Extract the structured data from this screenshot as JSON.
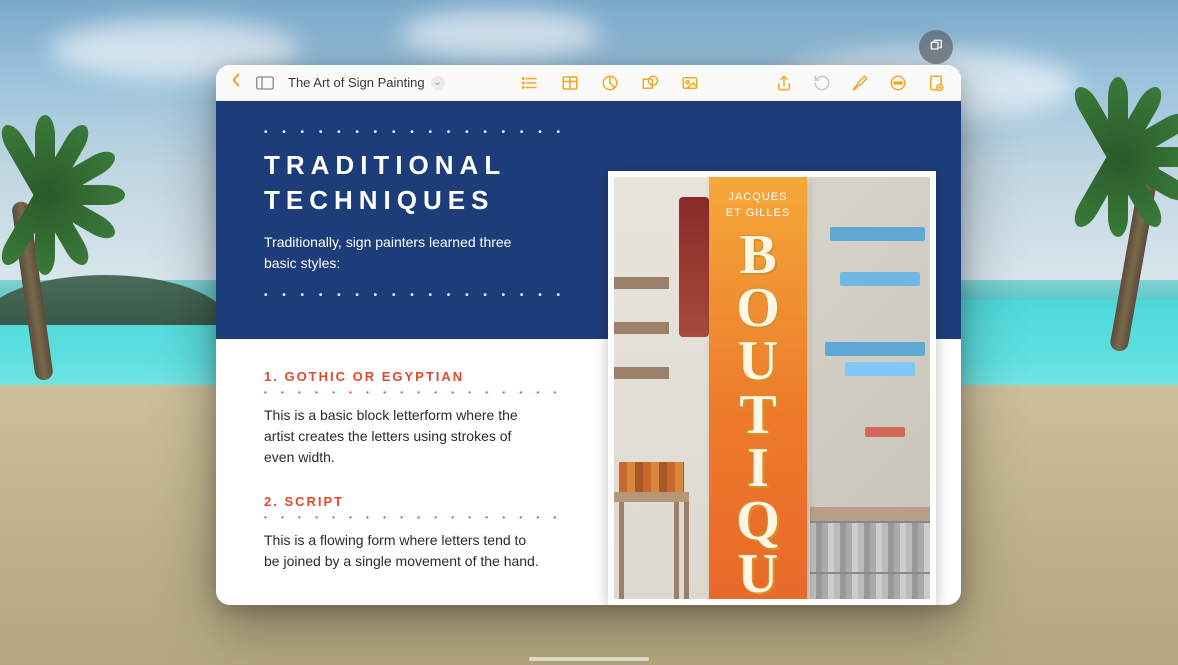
{
  "toolbar": {
    "title": "The Art of Sign Painting"
  },
  "document": {
    "heading_line1": "TRADITIONAL",
    "heading_line2": "TECHNIQUES",
    "subtitle": "Traditionally, sign painters learned three basic styles:",
    "items": [
      {
        "heading": "1.  GOTHIC OR EGYPTIAN",
        "body": "This is a basic block letterform where the artist creates the letters using strokes of even width."
      },
      {
        "heading": "2.  SCRIPT",
        "body": "This is a flowing form where letters tend to be joined by a single movement of the hand."
      }
    ],
    "photo": {
      "sign_header_line1": "JACQUES",
      "sign_header_line2": "ET GILLES",
      "sign_letters": [
        "B",
        "O",
        "U",
        "T",
        "I",
        "Q",
        "U"
      ]
    }
  }
}
